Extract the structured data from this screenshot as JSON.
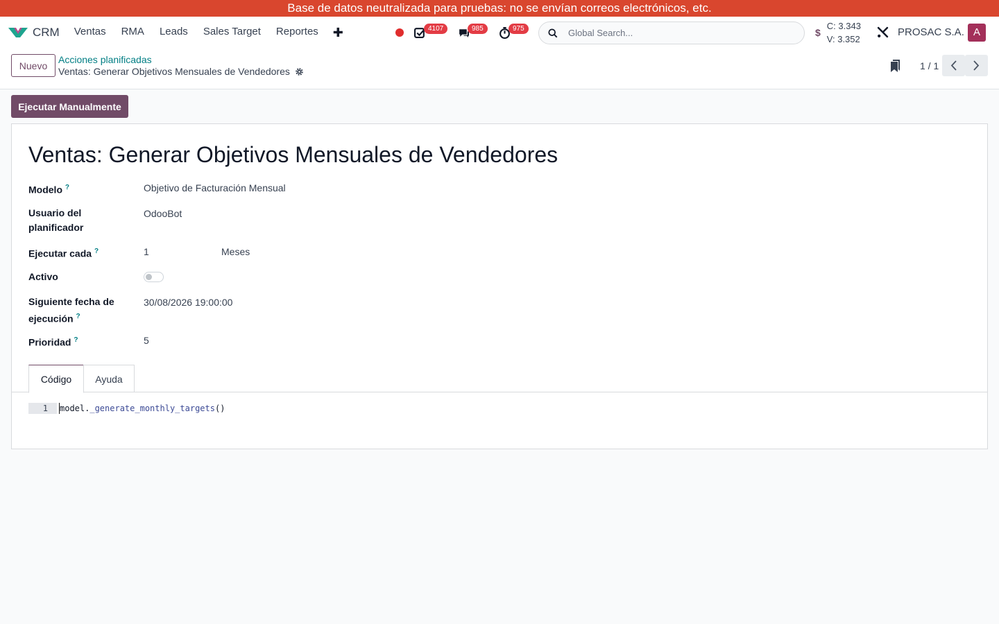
{
  "banner": {
    "text": "Base de datos neutralizada para pruebas: no se envían correos electrónicos, etc."
  },
  "navbar": {
    "app_name": "CRM",
    "menu": [
      "Ventas",
      "RMA",
      "Leads",
      "Sales Target",
      "Reportes"
    ],
    "plus": "✚",
    "badges": {
      "activities": "4107",
      "messages": "985",
      "timer": "975"
    },
    "search_placeholder": "Global Search...",
    "rates": {
      "buy": "C: 3.343",
      "sell": "V: 3.352"
    },
    "currency_symbol": "$",
    "company": "PROSAC S.A.",
    "avatar_letter": "A"
  },
  "control": {
    "new_label": "Nuevo",
    "breadcrumb_parent": "Acciones planificadas",
    "breadcrumb_current": "Ventas: Generar Objetivos Mensuales de Vendedores",
    "pager": "1 / 1"
  },
  "run_button": "Ejecutar Manualmente",
  "form": {
    "title": "Ventas: Generar Objetivos Mensuales de Vendedores",
    "fields": {
      "model": {
        "label": "Modelo",
        "help": "?",
        "value": "Objetivo de Facturación Mensual"
      },
      "user": {
        "label_line1": "Usuario del",
        "label_line2": "planificador",
        "value": "OdooBot"
      },
      "interval": {
        "label": "Ejecutar cada",
        "help": "?",
        "number": "1",
        "unit": "Meses"
      },
      "active": {
        "label": "Activo",
        "checked": false
      },
      "nextcall": {
        "label_line1": "Siguiente fecha de",
        "label_line2": "ejecución",
        "help": "?",
        "value": "30/08/2026 19:00:00"
      },
      "priority": {
        "label": "Prioridad",
        "help": "?",
        "value": "5"
      }
    },
    "tabs": [
      "Código",
      "Ayuda"
    ],
    "code": {
      "line_number": "1",
      "obj": "model",
      "dot": ".",
      "method": "_generate_monthly_targets",
      "parens": "()"
    }
  },
  "colors": {
    "primary": "#714b67",
    "link": "#017e84",
    "banner": "#d9462e",
    "badge": "#e33c45"
  }
}
